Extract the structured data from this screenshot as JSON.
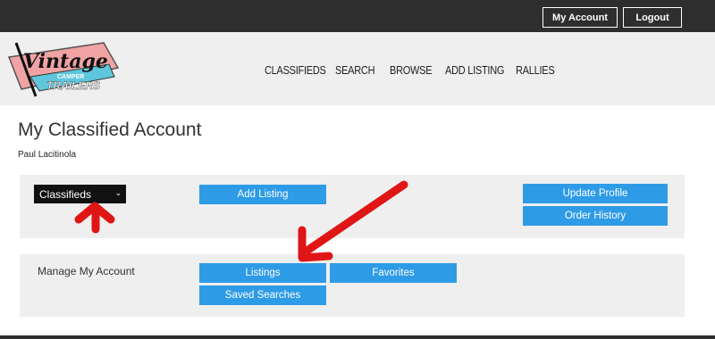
{
  "topbar": {
    "my_account": "My Account",
    "logout": "Logout"
  },
  "logo": {
    "line1": "Vintage",
    "line2": "CAMPER",
    "line3": "TRAILERS"
  },
  "nav": {
    "items": [
      "CLASSIFIEDS",
      "SEARCH",
      "BROWSE",
      "ADD LISTING",
      "RALLIES"
    ]
  },
  "page": {
    "title": "My Classified Account",
    "user_name": "Paul Lacitinola"
  },
  "panel1": {
    "select_value": "Classifieds",
    "add_listing": "Add Listing",
    "update_profile": "Update Profile",
    "order_history": "Order History"
  },
  "panel2": {
    "label": "Manage My Account",
    "listings": "Listings",
    "favorites": "Favorites",
    "saved_searches": "Saved Searches"
  },
  "colors": {
    "topbar": "#2e2e2e",
    "button_blue": "#2e9be6",
    "annotation_red": "#e01515",
    "panel_bg": "#efefef"
  }
}
